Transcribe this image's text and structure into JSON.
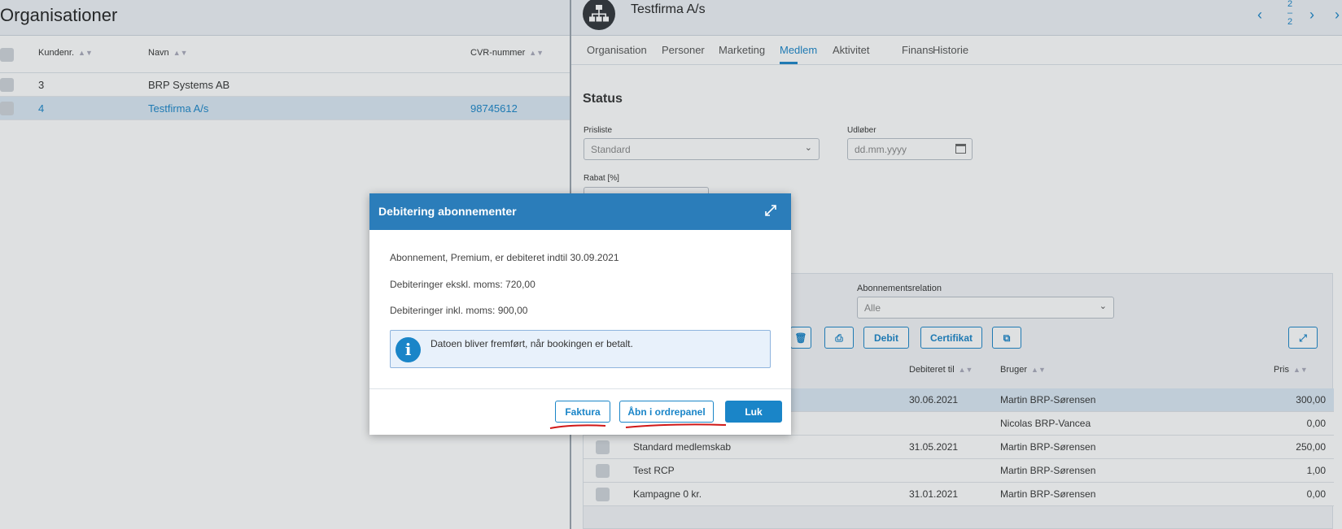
{
  "left": {
    "title": "Organisationer",
    "columns": [
      "Kundenr.",
      "Navn",
      "CVR-nummer"
    ],
    "rows": [
      {
        "kundenr": "3",
        "navn": "BRP Systems AB",
        "cvr": ""
      },
      {
        "kundenr": "4",
        "navn": "Testfirma A/s",
        "cvr": "98745612"
      }
    ]
  },
  "right": {
    "org_name": "Testfirma A/s",
    "pager": {
      "current": "2",
      "total": "2"
    },
    "tabs": [
      "Organisation",
      "Personer",
      "Marketing",
      "Medlem",
      "Aktivitet",
      "Finans",
      "Historie"
    ],
    "active_tab": "Medlem",
    "status_title": "Status",
    "prisliste_label": "Prisliste",
    "prisliste_value": "Standard",
    "udlober_label": "Udløber",
    "udlober_placeholder": "dd.mm.yyyy",
    "rabat_label": "Rabat [%]",
    "abonnementsrelation_label": "Abonnementsrelation",
    "abonnementsrelation_value": "Alle",
    "toolbar": {
      "debit": "Debit",
      "certifikat": "Certifikat"
    },
    "sub_columns": {
      "debiteret_til": "Debiteret til",
      "bruger": "Bruger",
      "pris": "Pris"
    },
    "sub_rows": [
      {
        "name": "",
        "debiteret_til": "30.06.2021",
        "bruger": "Martin BRP-Sørensen",
        "pris": "300,00"
      },
      {
        "name": "",
        "debiteret_til": "",
        "bruger": "Nicolas BRP-Vancea",
        "pris": "0,00"
      },
      {
        "name": "Standard medlemskab",
        "debiteret_til": "31.05.2021",
        "bruger": "Martin BRP-Sørensen",
        "pris": "250,00"
      },
      {
        "name": "Test RCP",
        "debiteret_til": "",
        "bruger": "Martin BRP-Sørensen",
        "pris": "1,00"
      },
      {
        "name": "Kampagne 0 kr.",
        "debiteret_til": "31.01.2021",
        "bruger": "Martin BRP-Sørensen",
        "pris": "0,00"
      }
    ]
  },
  "modal": {
    "title": "Debitering abonnementer",
    "line1": "Abonnement, Premium, er debiteret indtil 30.09.2021",
    "line2": "Debiteringer ekskl. moms: 720,00",
    "line3": "Debiteringer inkl. moms: 900,00",
    "info": "Datoen bliver fremført, når bookingen er betalt.",
    "buttons": {
      "faktura": "Faktura",
      "abn": "Åbn i ordrepanel",
      "luk": "Luk"
    }
  },
  "colors": {
    "accent": "#1a85c8",
    "header": "#2b7dba",
    "annotation": "#d01818"
  }
}
